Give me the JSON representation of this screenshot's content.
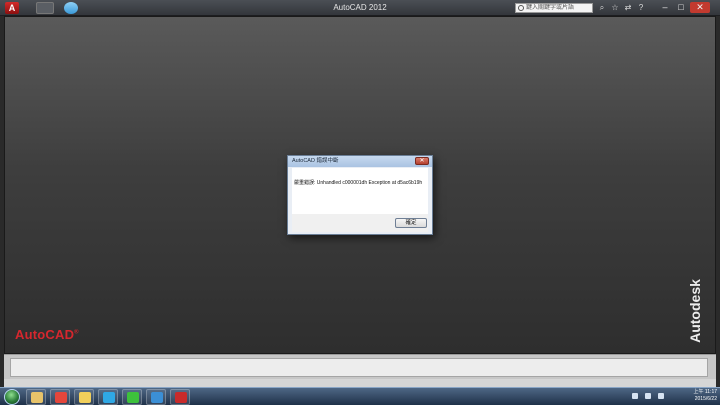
{
  "window": {
    "title": "AutoCAD 2012",
    "app_icon": "A",
    "search_placeholder": "鍵入關鍵字或片語"
  },
  "brand": {
    "autocad": "AutoCAD",
    "autocad_mark": "®",
    "autodesk": "Autodesk",
    "autocad_color": "#d6272e"
  },
  "dialog": {
    "title": "AutoCAD 錯誤中斷",
    "message": "嚴重錯誤: Unhandled c000001dh Exception at d5ac6b19h",
    "ok_label": "確定",
    "close_glyph": "✕"
  },
  "taskbar": {
    "items": [
      {
        "icon": "file-explorer-icon",
        "color": "#e7c36a"
      },
      {
        "icon": "chrome-icon",
        "color": "#e4463b"
      },
      {
        "icon": "folder-icon",
        "color": "#f1cf5b"
      },
      {
        "icon": "skype-icon",
        "color": "#2fa8e5"
      },
      {
        "icon": "line-icon",
        "color": "#3dc13c"
      },
      {
        "icon": "internet-explorer-icon",
        "color": "#3b8fd6"
      },
      {
        "icon": "autocad-icon",
        "color": "#c92b2b"
      }
    ],
    "clock_time": "上午 11:17",
    "clock_date": "2015/6/22"
  }
}
